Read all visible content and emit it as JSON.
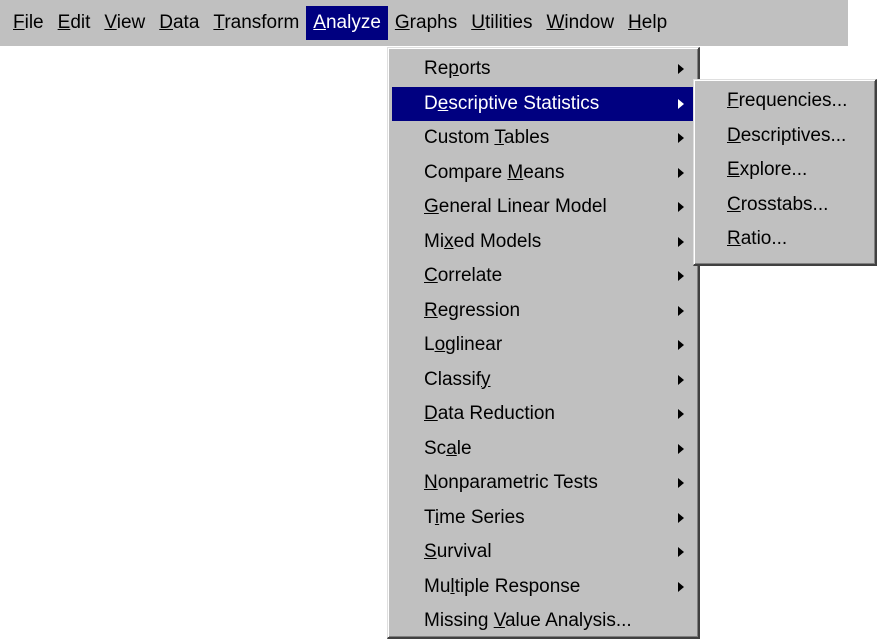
{
  "menubar": {
    "items": [
      {
        "label": "File",
        "key": "F"
      },
      {
        "label": "Edit",
        "key": "E"
      },
      {
        "label": "View",
        "key": "V"
      },
      {
        "label": "Data",
        "key": "D"
      },
      {
        "label": "Transform",
        "key": "T"
      },
      {
        "label": "Analyze",
        "key": "A",
        "active": true
      },
      {
        "label": "Graphs",
        "key": "G"
      },
      {
        "label": "Utilities",
        "key": "U"
      },
      {
        "label": "Window",
        "key": "W"
      },
      {
        "label": "Help",
        "key": "H"
      }
    ]
  },
  "analyze_menu": {
    "items": [
      {
        "label": "Reports",
        "key": "p",
        "submenu": true
      },
      {
        "label": "Descriptive Statistics",
        "key": "e",
        "submenu": true,
        "active": true
      },
      {
        "label": "Custom Tables",
        "key": "T",
        "submenu": true
      },
      {
        "label": "Compare Means",
        "key": "M",
        "submenu": true
      },
      {
        "label": "General Linear Model",
        "key": "G",
        "submenu": true
      },
      {
        "label": "Mixed Models",
        "key": "x",
        "submenu": true
      },
      {
        "label": "Correlate",
        "key": "C",
        "submenu": true
      },
      {
        "label": "Regression",
        "key": "R",
        "submenu": true
      },
      {
        "label": "Loglinear",
        "key": "o",
        "submenu": true
      },
      {
        "label": "Classify",
        "key": "y",
        "submenu": true
      },
      {
        "label": "Data Reduction",
        "key": "D",
        "submenu": true
      },
      {
        "label": "Scale",
        "key": "a",
        "submenu": true
      },
      {
        "label": "Nonparametric Tests",
        "key": "N",
        "submenu": true
      },
      {
        "label": "Time Series",
        "key": "i",
        "submenu": true
      },
      {
        "label": "Survival",
        "key": "S",
        "submenu": true
      },
      {
        "label": "Multiple Response",
        "key": "l",
        "submenu": true
      },
      {
        "label": "Missing Value Analysis...",
        "key": "V",
        "submenu": false
      }
    ]
  },
  "descriptive_submenu": {
    "items": [
      {
        "label": "Frequencies...",
        "key": "F"
      },
      {
        "label": "Descriptives...",
        "key": "D"
      },
      {
        "label": "Explore...",
        "key": "E"
      },
      {
        "label": "Crosstabs...",
        "key": "C"
      },
      {
        "label": "Ratio...",
        "key": "R"
      }
    ]
  }
}
